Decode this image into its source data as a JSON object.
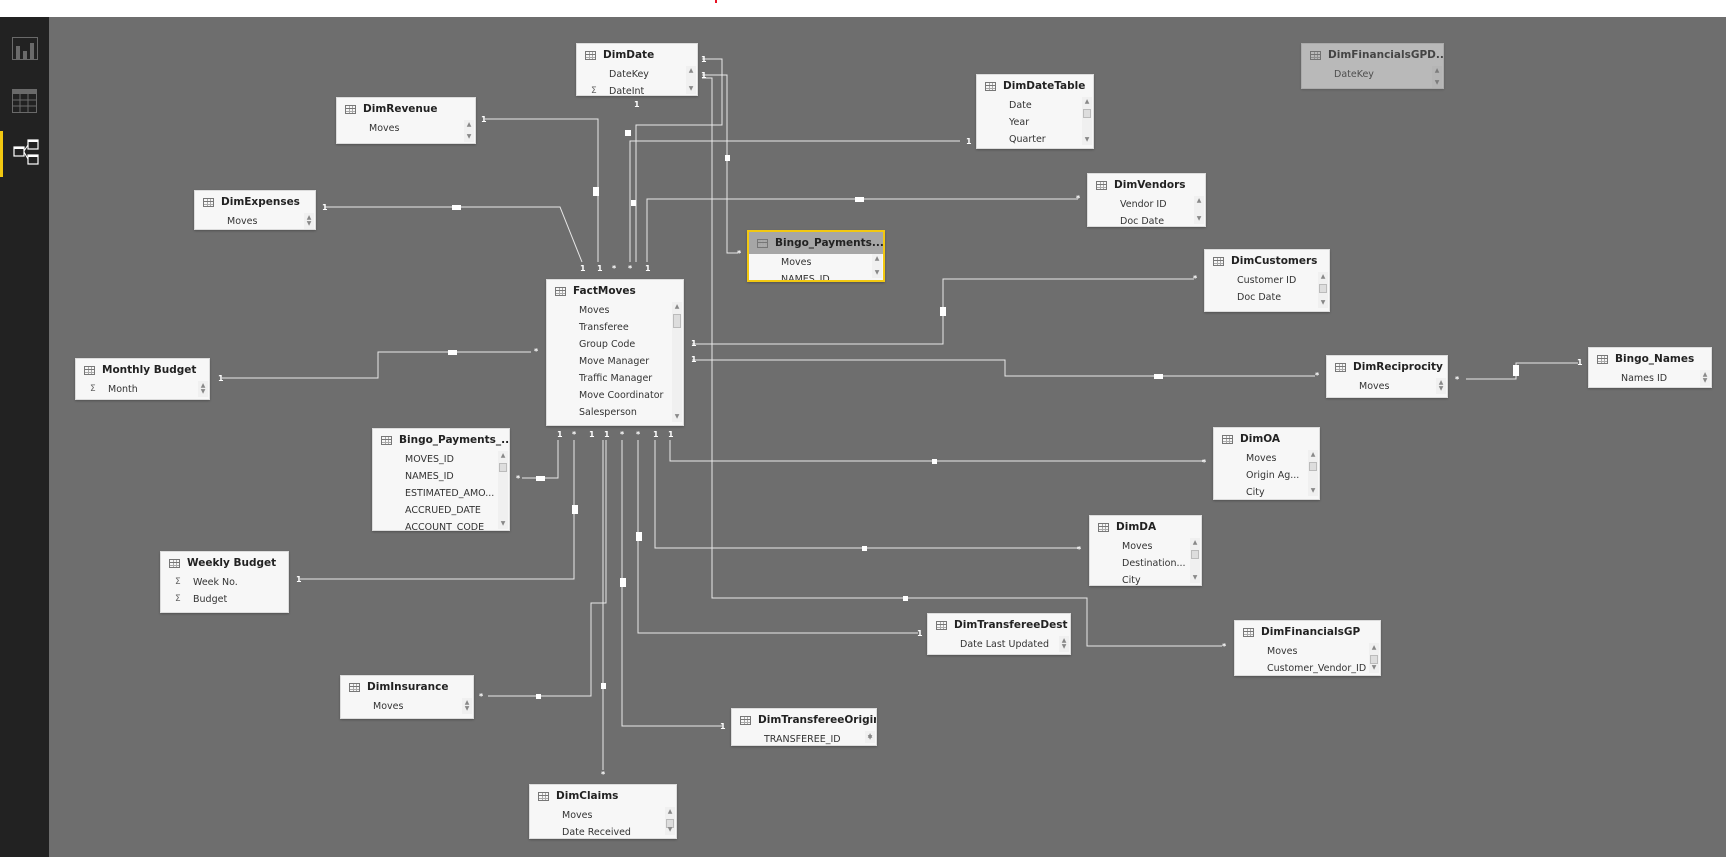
{
  "nav": {
    "items": [
      {
        "name": "report-view",
        "icon": "bar-chart-icon",
        "active": false
      },
      {
        "name": "data-view",
        "icon": "table-grid-icon",
        "active": false
      },
      {
        "name": "relationships-view",
        "icon": "relationships-icon",
        "active": true
      }
    ]
  },
  "colors": {
    "accent": "#f2c811",
    "canvas": "#6e6e6e",
    "nav": "#222222",
    "line": "#ffffff"
  },
  "tables": {
    "dimdate": {
      "title": "DimDate",
      "fields": [
        {
          "name": "DateKey",
          "sigma": false
        },
        {
          "name": "DateInt",
          "sigma": true
        }
      ]
    },
    "dimfinancialsgpd": {
      "title": "DimFinancialsGPD...",
      "fields": [
        {
          "name": "DateKey",
          "sigma": false
        }
      ]
    },
    "dimrevenue": {
      "title": "DimRevenue",
      "fields": [
        {
          "name": "Moves",
          "sigma": false
        }
      ]
    },
    "dimdatetable": {
      "title": "DimDateTable",
      "fields": [
        {
          "name": "Date",
          "sigma": false
        },
        {
          "name": "Year",
          "sigma": false
        },
        {
          "name": "Quarter",
          "sigma": false
        }
      ]
    },
    "dimvendors": {
      "title": "DimVendors",
      "fields": [
        {
          "name": "Vendor ID",
          "sigma": false
        },
        {
          "name": "Doc Date",
          "sigma": false
        }
      ]
    },
    "dimexpenses": {
      "title": "DimExpenses",
      "fields": [
        {
          "name": "Moves",
          "sigma": false
        }
      ]
    },
    "bingopayments_top": {
      "title": "Bingo_Payments...",
      "fields": [
        {
          "name": "Moves",
          "sigma": false
        },
        {
          "name": "NAMES_ID",
          "sigma": false
        }
      ]
    },
    "dimcustomers": {
      "title": "DimCustomers",
      "fields": [
        {
          "name": "Customer ID",
          "sigma": false
        },
        {
          "name": "Doc Date",
          "sigma": false
        }
      ]
    },
    "factmoves": {
      "title": "FactMoves",
      "fields": [
        {
          "name": "Moves",
          "sigma": false
        },
        {
          "name": "Transferee",
          "sigma": false
        },
        {
          "name": "Group Code",
          "sigma": false
        },
        {
          "name": "Move Manager",
          "sigma": false
        },
        {
          "name": "Traffic Manager",
          "sigma": false
        },
        {
          "name": "Move Coordinator",
          "sigma": false
        },
        {
          "name": "Salesperson",
          "sigma": false
        }
      ]
    },
    "monthlybudget": {
      "title": "Monthly Budget",
      "fields": [
        {
          "name": "Month",
          "sigma": true
        }
      ]
    },
    "dimreciprocity": {
      "title": "DimReciprocity",
      "fields": [
        {
          "name": "Moves",
          "sigma": false
        }
      ]
    },
    "bingonames": {
      "title": "Bingo_Names",
      "fields": [
        {
          "name": "Names ID",
          "sigma": false
        }
      ]
    },
    "bingopayments_left": {
      "title": "Bingo_Payments_...",
      "fields": [
        {
          "name": "MOVES_ID",
          "sigma": false
        },
        {
          "name": "NAMES_ID",
          "sigma": false
        },
        {
          "name": "ESTIMATED_AMO...",
          "sigma": false
        },
        {
          "name": "ACCRUED_DATE",
          "sigma": false
        },
        {
          "name": "ACCOUNT_CODE",
          "sigma": false
        }
      ]
    },
    "dimoa": {
      "title": "DimOA",
      "fields": [
        {
          "name": "Moves",
          "sigma": false
        },
        {
          "name": "Origin Ag...",
          "sigma": false
        },
        {
          "name": "City",
          "sigma": false
        }
      ]
    },
    "weeklybudget": {
      "title": "Weekly Budget",
      "fields": [
        {
          "name": "Week No.",
          "sigma": true
        },
        {
          "name": "Budget",
          "sigma": true
        }
      ]
    },
    "dimda": {
      "title": "DimDA",
      "fields": [
        {
          "name": "Moves",
          "sigma": false
        },
        {
          "name": "Destination...",
          "sigma": false
        },
        {
          "name": "City",
          "sigma": false
        }
      ]
    },
    "dimtransfereedest": {
      "title": "DimTransfereeDest",
      "fields": [
        {
          "name": "Date Last Updated",
          "sigma": false
        }
      ]
    },
    "dimfinancialsgp": {
      "title": "DimFinancialsGP",
      "fields": [
        {
          "name": "Moves",
          "sigma": false
        },
        {
          "name": "Customer_Vendor_ID",
          "sigma": false
        }
      ]
    },
    "diminsurance": {
      "title": "DimInsurance",
      "fields": [
        {
          "name": "Moves",
          "sigma": false
        }
      ]
    },
    "dimtransfereeorigin": {
      "title": "DimTransfereeOrigin",
      "fields": [
        {
          "name": "TRANSFEREE_ID",
          "sigma": false
        }
      ]
    },
    "dimclaims": {
      "title": "DimClaims",
      "fields": [
        {
          "name": "Moves",
          "sigma": false
        },
        {
          "name": "Date Received",
          "sigma": false
        }
      ]
    }
  },
  "relationships": [
    {
      "from": "DimDate",
      "to": "FactMoves",
      "from_card": "1",
      "to_card": "1"
    },
    {
      "from": "DimDate",
      "to": "Bingo_Payments...",
      "from_card": "1",
      "to_card": "*"
    },
    {
      "from": "DimDate",
      "to": "DimFinancialsGP",
      "from_card": "1",
      "to_card": "*"
    },
    {
      "from": "DimRevenue",
      "to": "FactMoves",
      "from_card": "1",
      "to_card": "1"
    },
    {
      "from": "DimDateTable",
      "to": "FactMoves",
      "from_card": "1",
      "to_card": "*"
    },
    {
      "from": "DimExpenses",
      "to": "FactMoves",
      "from_card": "1",
      "to_card": "1"
    },
    {
      "from": "DimVendors",
      "to": "FactMoves",
      "from_card": "*",
      "to_card": "1"
    },
    {
      "from": "FactMoves",
      "to": "DimCustomers",
      "from_card": "1",
      "to_card": "*"
    },
    {
      "from": "Monthly Budget",
      "to": "FactMoves",
      "from_card": "1",
      "to_card": "*"
    },
    {
      "from": "FactMoves",
      "to": "DimReciprocity",
      "from_card": "1",
      "to_card": "*"
    },
    {
      "from": "DimReciprocity",
      "to": "Bingo_Names",
      "from_card": "*",
      "to_card": "1"
    },
    {
      "from": "Bingo_Payments_...",
      "to": "FactMoves",
      "from_card": "*",
      "to_card": "1"
    },
    {
      "from": "FactMoves",
      "to": "DimOA",
      "from_card": "1",
      "to_card": "*"
    },
    {
      "from": "Weekly Budget",
      "to": "FactMoves",
      "from_card": "1",
      "to_card": "*"
    },
    {
      "from": "FactMoves",
      "to": "DimDA",
      "from_card": "1",
      "to_card": "*"
    },
    {
      "from": "FactMoves",
      "to": "DimTransfereeDest",
      "from_card": "*",
      "to_card": "1"
    },
    {
      "from": "DimInsurance",
      "to": "FactMoves",
      "from_card": "*",
      "to_card": "1"
    },
    {
      "from": "FactMoves",
      "to": "DimTransfereeOrigin",
      "from_card": "*",
      "to_card": "1"
    },
    {
      "from": "FactMoves",
      "to": "DimClaims",
      "from_card": "1",
      "to_card": "*"
    }
  ]
}
